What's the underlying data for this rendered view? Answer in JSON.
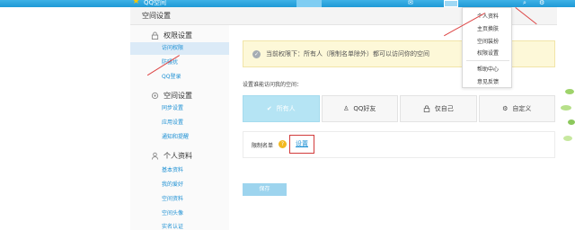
{
  "topbar": {
    "brand": "QQ空间"
  },
  "page_header": {
    "title": "空间设置"
  },
  "sidebar": {
    "sections": [
      {
        "title": "权限设置",
        "items": [
          "访问权限",
          "防骚扰",
          "QQ登录"
        ]
      },
      {
        "title": "空间设置",
        "items": [
          "同步设置",
          "应用设置",
          "通知和提醒"
        ]
      },
      {
        "title": "个人资料",
        "items": [
          "基本资料",
          "我的爱好",
          "空间资料",
          "空间头像",
          "实名认证"
        ]
      }
    ]
  },
  "notice": {
    "text": "当前权限下：所有人（限制名单除外）都可以访问你的空间"
  },
  "access": {
    "label": "设置谁能访问我的空间：",
    "options": [
      "所有人",
      "QQ好友",
      "仅自己",
      "自定义"
    ]
  },
  "blocklist": {
    "label": "限制名单",
    "set_label": "设置"
  },
  "save_label": "保存",
  "dropdown": {
    "items": [
      "个人资料",
      "主页换肤",
      "空间装扮",
      "权限设置",
      "帮助中心",
      "意见反馈"
    ]
  },
  "colors": {
    "accent": "#1b8fd3",
    "topbar": "#1f9ad6",
    "selected_option": "#b5e4f4",
    "annotation": "#d44444"
  }
}
